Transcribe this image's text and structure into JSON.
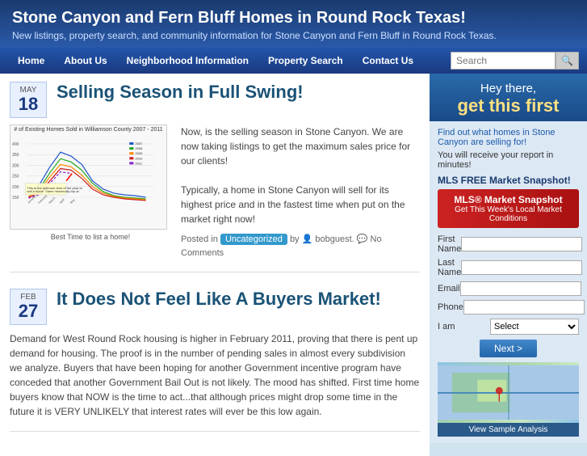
{
  "header": {
    "title": "Stone Canyon and Fern Bluff Homes in Round Rock Texas!",
    "subtitle": "New listings, property search, and community information for Stone Canyon and Fern Bluff in Round Rock Texas."
  },
  "nav": {
    "items": [
      {
        "label": "Home",
        "id": "home"
      },
      {
        "label": "About Us",
        "id": "about"
      },
      {
        "label": "Neighborhood Information",
        "id": "neighborhood"
      },
      {
        "label": "Property Search",
        "id": "property-search"
      },
      {
        "label": "Contact Us",
        "id": "contact"
      }
    ],
    "search_placeholder": "Search"
  },
  "post1": {
    "date_month": "MAY",
    "date_day": "18",
    "title": "Selling Season in Full Swing!",
    "body1": "Now, is the selling season in Stone Canyon. We are now taking listings to get the maximum sales price for our clients!",
    "body2": "Typically, a home in Stone Canyon will sell for its highest price and in the fastest time when put on the market right now!",
    "meta_prefix": "Posted in",
    "category": "Uncategorized",
    "meta_by": "by",
    "author": "bobguest.",
    "comments": "No Comments",
    "chart_title": "# of Existing Homes Sold in Williamson County 2007 - 2011",
    "chart_caption": "Best Time to list a home!"
  },
  "post2": {
    "date_month": "FEB",
    "date_day": "27",
    "title": "It Does Not Feel Like A Buyers Market!",
    "body": "Demand for West Round Rock housing is higher in February 2011, proving that there is pent up demand for housing. The proof is in the number of pending sales in almost every subdivision we analyze. Buyers that have been hoping for another Government incentive program have conceded that another Government Bail Out is not likely. The mood has shifted. First time home buyers know that NOW is the time to act...that although prices might drop some time in the future it is VERY UNLIKELY that interest rates will ever be this low again."
  },
  "sidebar": {
    "hey": "Hey there,",
    "get_this": "get this first",
    "desc1": "Find out what homes in Stone Canyon are selling for!",
    "desc2": "You will receive your report in minutes!",
    "mls_label": "MLS FREE Market Snapshot!",
    "mls_banner_title": "MLS® Market Snapshot",
    "mls_banner_sub": "Get This Week's Local Market Conditions",
    "form": {
      "first_name_label": "First Name",
      "last_name_label": "Last Name",
      "email_label": "Email",
      "phone_label": "Phone",
      "i_am_label": "I am",
      "select_default": "Select"
    },
    "next_button": "Next >",
    "view_sample": "View Sample Analysis"
  }
}
